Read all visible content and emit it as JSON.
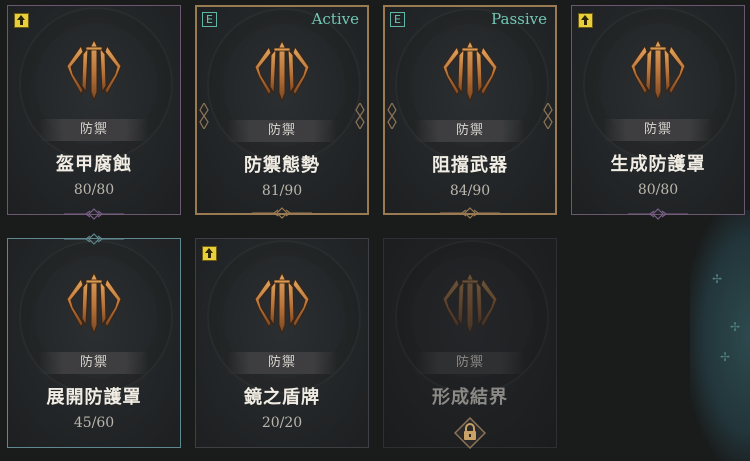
{
  "colors": {
    "upgrade_badge": "#e9cf3a",
    "status_text": "#72c8b4",
    "gold_border": "#9a7a52",
    "emblem": "#c98a4a"
  },
  "cards": [
    {
      "category": "防禦",
      "name": "盔甲腐蝕",
      "count": "80/80",
      "badge": "upgrade-icon"
    },
    {
      "category": "防禦",
      "name": "防禦態勢",
      "count": "81/90",
      "slot_key": "E",
      "status": "Active"
    },
    {
      "category": "防禦",
      "name": "阻擋武器",
      "count": "84/90",
      "slot_key": "E",
      "status": "Passive"
    },
    {
      "category": "防禦",
      "name": "生成防護罩",
      "count": "80/80",
      "badge": "upgrade-icon"
    },
    {
      "category": "防禦",
      "name": "展開防護罩",
      "count": "45/60"
    },
    {
      "category": "防禦",
      "name": "鏡之盾牌",
      "count": "20/20",
      "badge": "upgrade-icon"
    },
    {
      "category": "防禦",
      "name": "形成結界",
      "locked": true,
      "lock_icon": "padlock-icon"
    }
  ]
}
